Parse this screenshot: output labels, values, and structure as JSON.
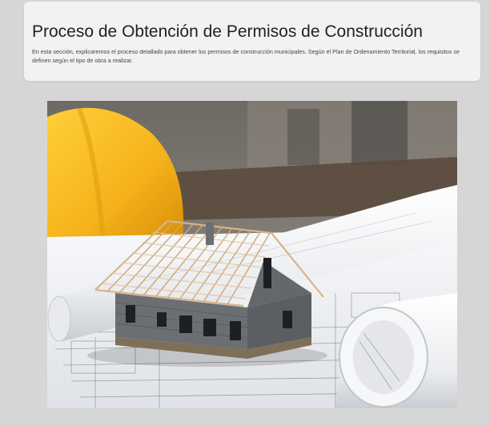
{
  "section": {
    "title": "Proceso de Obtención de Permisos de Construcción",
    "description": "En esta sección, explicaremos el proceso detallado para obtener los permisos de construcción municipales. Según el Plan de Ordenamiento Territorial, los requisitos se definen según el tipo de obra a realizar."
  },
  "hero_image": {
    "icon": "house-model-blueprints-image",
    "colors": {
      "helmet": "#f5b21a",
      "house_walls": "#6b6e72",
      "roof_timber": "#d9b58a",
      "blueprint": "#f4f5f7"
    }
  }
}
